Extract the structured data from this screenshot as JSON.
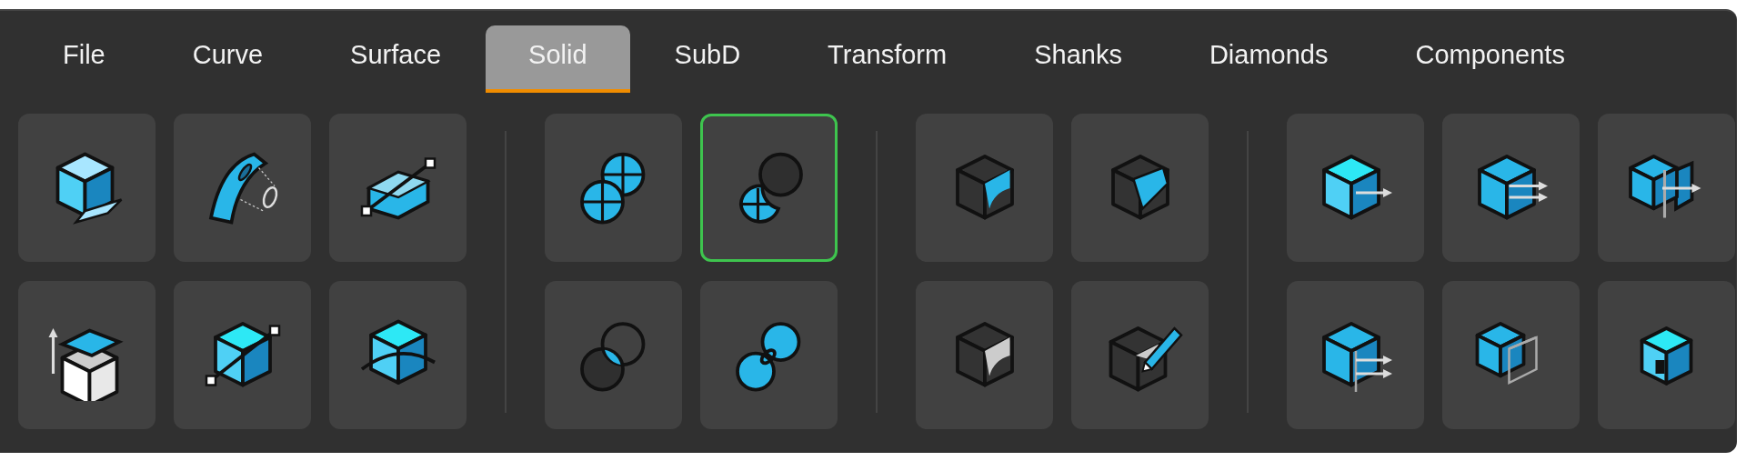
{
  "tabs": [
    {
      "label": "File",
      "selected": false
    },
    {
      "label": "Curve",
      "selected": false
    },
    {
      "label": "Surface",
      "selected": false
    },
    {
      "label": "Solid",
      "selected": true
    },
    {
      "label": "SubD",
      "selected": false
    },
    {
      "label": "Transform",
      "selected": false
    },
    {
      "label": "Shanks",
      "selected": false
    },
    {
      "label": "Diamonds",
      "selected": false
    },
    {
      "label": "Components",
      "selected": false
    }
  ],
  "tool_groups": [
    {
      "buttons": [
        {
          "selected": false
        },
        {
          "selected": false
        },
        {
          "selected": false
        },
        {
          "selected": false
        },
        {
          "selected": false
        },
        {
          "selected": false
        }
      ]
    },
    {
      "buttons": [
        {
          "selected": false
        },
        {
          "selected": true
        },
        {
          "selected": false
        },
        {
          "selected": false
        }
      ]
    },
    {
      "buttons": [
        {
          "selected": false
        },
        {
          "selected": false
        },
        {
          "selected": false
        },
        {
          "selected": false
        }
      ]
    },
    {
      "buttons": [
        {
          "selected": false
        },
        {
          "selected": false
        },
        {
          "selected": false
        },
        {
          "selected": false
        },
        {
          "selected": false
        },
        {
          "selected": false
        }
      ]
    }
  ]
}
